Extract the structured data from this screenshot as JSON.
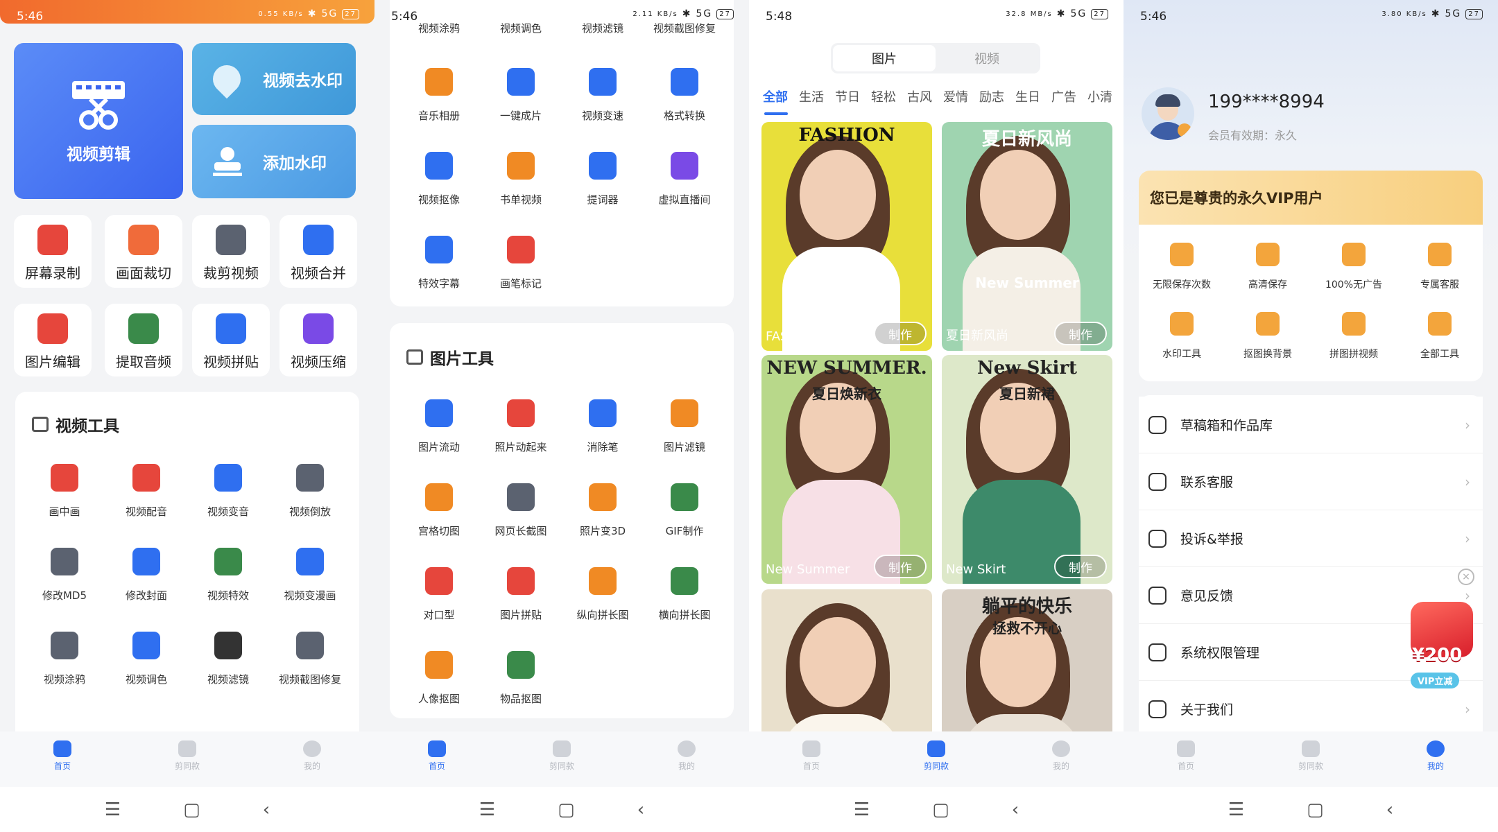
{
  "colors": {
    "accent": "#2f6ff0",
    "vip_gold": "#f3a53c",
    "red": "#e6463c"
  },
  "statusbar": {
    "s1": {
      "time": "5:46",
      "net": "0.55 KB/s",
      "signal": "5G",
      "battery": "27"
    },
    "s2": {
      "time": "5:46",
      "net": "2.11 KB/s",
      "signal": "5G",
      "battery": "27"
    },
    "s3": {
      "time": "5:48",
      "net": "32.8 MB/s",
      "signal": "5G",
      "battery": "27"
    },
    "s4": {
      "time": "5:46",
      "net": "3.80 KB/s",
      "signal": "5G",
      "battery": "27"
    }
  },
  "tabbar": {
    "home": "首页",
    "template": "剪同款",
    "mine": "我的"
  },
  "navbar": {
    "menu": "☰",
    "home": "▢",
    "back": "‹"
  },
  "home": {
    "edit_label": "视频剪辑",
    "watermark_remove": "视频去水印",
    "watermark_add": "添加水印",
    "quick": [
      {
        "label": "屏幕录制",
        "icon": "film-reel-icon",
        "color": "#e6463c"
      },
      {
        "label": "画面裁切",
        "icon": "crop-frame-icon",
        "color": "#f06b3a"
      },
      {
        "label": "裁剪视频",
        "icon": "crop-icon",
        "color": "#5b6270"
      },
      {
        "label": "视频合并",
        "icon": "merge-icon",
        "color": "#2f6ff0"
      },
      {
        "label": "图片编辑",
        "icon": "image-edit-icon",
        "color": "#e6463c"
      },
      {
        "label": "提取音频",
        "icon": "headphones-icon",
        "color": "#3a8a4a"
      },
      {
        "label": "视频拼贴",
        "icon": "film-strip-icon",
        "color": "#2f6ff0"
      },
      {
        "label": "视频压缩",
        "icon": "zip-icon",
        "color": "#7a4ae6"
      }
    ],
    "video_tools_title": "视频工具",
    "video_tools": [
      {
        "label": "画中画",
        "icon": "pip-icon",
        "color": "#e6463c"
      },
      {
        "label": "视频配音",
        "icon": "microphone-icon",
        "color": "#e6463c"
      },
      {
        "label": "视频变音",
        "icon": "waveform-icon",
        "color": "#2f6ff0"
      },
      {
        "label": "视频倒放",
        "icon": "rewind-icon",
        "color": "#5b6270"
      },
      {
        "label": "修改MD5",
        "icon": "md5-file-icon",
        "color": "#5b6270"
      },
      {
        "label": "修改封面",
        "icon": "book-cover-icon",
        "color": "#2f6ff0"
      },
      {
        "label": "视频特效",
        "icon": "sparkle-icon",
        "color": "#3a8a4a"
      },
      {
        "label": "视频变漫画",
        "icon": "star-icon",
        "color": "#2f6ff0"
      },
      {
        "label": "视频涂鸦",
        "icon": "clapper-icon",
        "color": "#5b6270"
      },
      {
        "label": "视频调色",
        "icon": "palette-icon",
        "color": "#2f6ff0"
      },
      {
        "label": "视频滤镜",
        "icon": "half-circle-icon",
        "color": "#333333"
      },
      {
        "label": "视频截图修复",
        "icon": "screenshot-repair-icon",
        "color": "#5b6270"
      }
    ]
  },
  "tools": {
    "top_row": [
      "视频涂鸦",
      "视频调色",
      "视频滤镜",
      "视频截图修复"
    ],
    "video_more": [
      {
        "label": "音乐相册",
        "icon": "music-album-icon",
        "color": "#f08a24"
      },
      {
        "label": "一键成片",
        "icon": "magic-film-icon",
        "color": "#2f6ff0"
      },
      {
        "label": "视频变速",
        "icon": "speedometer-icon",
        "color": "#2f6ff0"
      },
      {
        "label": "格式转换",
        "icon": "convert-icon",
        "color": "#2f6ff0"
      },
      {
        "label": "视频抠像",
        "icon": "monitor-icon",
        "color": "#2f6ff0"
      },
      {
        "label": "书单视频",
        "icon": "book-icon",
        "color": "#f08a24"
      },
      {
        "label": "提词器",
        "icon": "prompter-icon",
        "color": "#2f6ff0"
      },
      {
        "label": "虚拟直播间",
        "icon": "tv-icon",
        "color": "#7a4ae6"
      },
      {
        "label": "特效字幕",
        "icon": "subtitle-icon",
        "color": "#2f6ff0"
      },
      {
        "label": "画笔标记",
        "icon": "flag-icon",
        "color": "#e6463c"
      }
    ],
    "image_tools_title": "图片工具",
    "image_tools": [
      {
        "label": "图片流动",
        "icon": "waves-icon",
        "color": "#2f6ff0"
      },
      {
        "label": "照片动起来",
        "icon": "photo-motion-icon",
        "color": "#e6463c"
      },
      {
        "label": "消除笔",
        "icon": "eraser-icon",
        "color": "#2f6ff0"
      },
      {
        "label": "图片滤镜",
        "icon": "sparkles-icon",
        "color": "#f08a24"
      },
      {
        "label": "宫格切图",
        "icon": "grid-icon",
        "color": "#f08a24"
      },
      {
        "label": "网页长截图",
        "icon": "long-screenshot-icon",
        "color": "#5b6270"
      },
      {
        "label": "照片变3D",
        "icon": "cube-icon",
        "color": "#f08a24"
      },
      {
        "label": "GIF制作",
        "icon": "gif-icon",
        "color": "#3a8a4a"
      },
      {
        "label": "对口型",
        "icon": "lips-icon",
        "color": "#e6463c"
      },
      {
        "label": "图片拼贴",
        "icon": "collage-icon",
        "color": "#e6463c"
      },
      {
        "label": "纵向拼长图",
        "icon": "vertical-join-icon",
        "color": "#f08a24"
      },
      {
        "label": "横向拼长图",
        "icon": "horizontal-join-icon",
        "color": "#3a8a4a"
      },
      {
        "label": "人像抠图",
        "icon": "portrait-cutout-icon",
        "color": "#f08a24"
      },
      {
        "label": "物品抠图",
        "icon": "object-cutout-icon",
        "color": "#3a8a4a"
      }
    ]
  },
  "templates": {
    "seg_image": "图片",
    "seg_video": "视频",
    "categories": [
      "全部",
      "生活",
      "节日",
      "轻松",
      "古风",
      "爱情",
      "励志",
      "生日",
      "广告",
      "小清"
    ],
    "make_label": "制作",
    "posters": [
      {
        "title": "FASHION",
        "headline": "FASHION",
        "bg": "#e8df3a",
        "body": "#ffffff"
      },
      {
        "title": "夏日新风尚",
        "headline": "夏日新风尚",
        "sub": "New Summer",
        "bg": "#9fd4b0",
        "body": "#f4efe6"
      },
      {
        "title": "New Summer",
        "headline": "NEW SUMMER.",
        "sub": "夏日焕新衣",
        "bg": "#b8d88a",
        "body": "#f7e0e6"
      },
      {
        "title": "New Skirt",
        "headline": "New Skirt",
        "sub": "夏日新裙",
        "bg": "#dde8c9",
        "body": "#3d8a6a"
      },
      {
        "title": "",
        "headline": "",
        "bg": "#e9e0cc",
        "body": "#faf5ec"
      },
      {
        "title": "",
        "headline": "躺平的快乐",
        "sub": "拯救不开心",
        "bg": "#d8cfc4",
        "body": "#e9e1d6"
      }
    ]
  },
  "profile": {
    "phone": "199****8994",
    "member": "会员有效期：永久",
    "vip_banner": "您已是尊贵的永久VIP用户",
    "benefits": [
      {
        "label": "无限保存次数",
        "icon": "infinity-icon"
      },
      {
        "label": "高清保存",
        "icon": "hd-camera-icon"
      },
      {
        "label": "100%无广告",
        "icon": "no-ad-icon"
      },
      {
        "label": "专属客服",
        "icon": "headset-icon"
      },
      {
        "label": "水印工具",
        "icon": "watermark-icon"
      },
      {
        "label": "抠图换背景",
        "icon": "cutout-icon"
      },
      {
        "label": "拼图拼视频",
        "icon": "puzzle-icon"
      },
      {
        "label": "全部工具",
        "icon": "box-icon"
      }
    ],
    "menu": [
      {
        "label": "草稿箱和作品库",
        "icon": "drafts-icon"
      },
      {
        "label": "联系客服",
        "icon": "support-icon"
      },
      {
        "label": "投诉&举报",
        "icon": "report-icon"
      },
      {
        "label": "意见反馈",
        "icon": "feedback-icon"
      },
      {
        "label": "系统权限管理",
        "icon": "shield-icon"
      },
      {
        "label": "关于我们",
        "icon": "about-icon"
      }
    ],
    "promo_amount": "¥200",
    "promo_label": "VIP立减"
  }
}
